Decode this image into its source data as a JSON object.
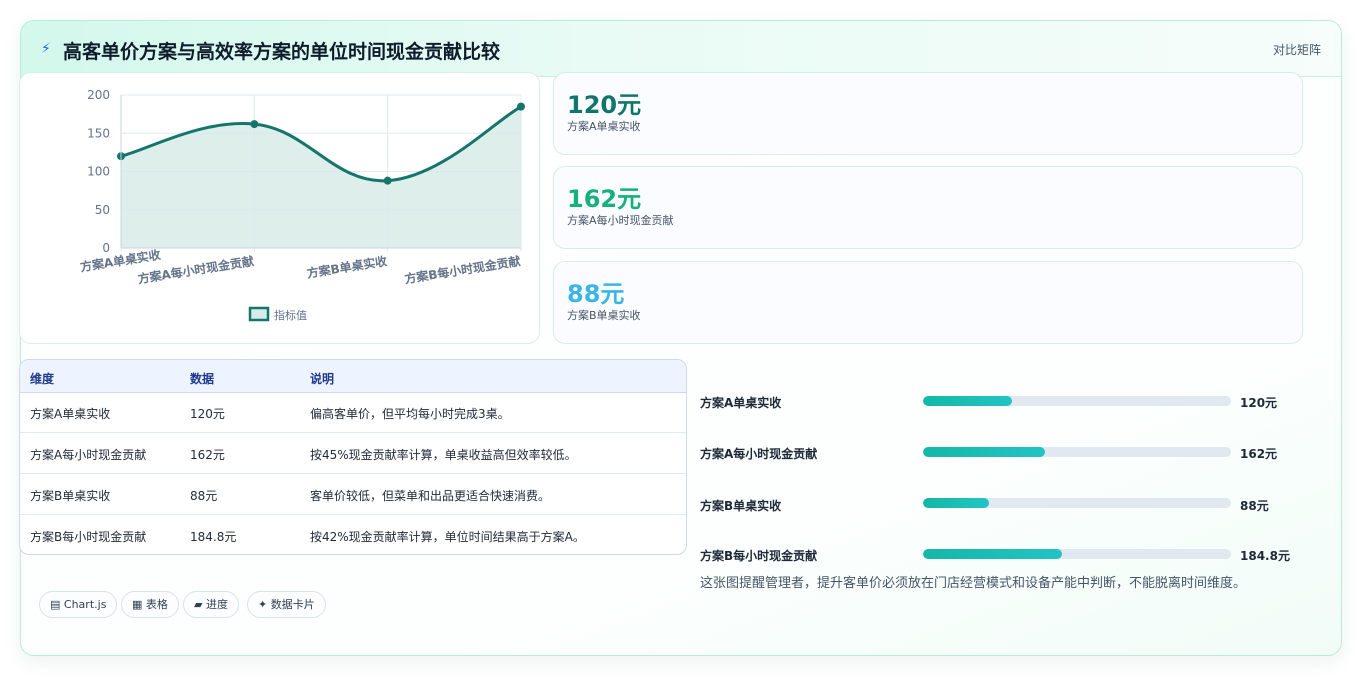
{
  "header": {
    "title": "高客单价方案与高效率方案的单位时间现金贡献比较",
    "matrix_label": "对比矩阵"
  },
  "chart_data": {
    "type": "line",
    "categories": [
      "方案A单桌实收",
      "方案A每小时现金贡献",
      "方案B单桌实收",
      "方案B每小时现金贡献"
    ],
    "series": [
      {
        "name": "指标值",
        "values": [
          120,
          162,
          88,
          184.8
        ]
      }
    ],
    "ylim": [
      0,
      200
    ],
    "yticks": [
      0,
      50,
      100,
      150,
      200
    ],
    "legend": "bottom",
    "grid": true,
    "colors": {
      "line": "#16756b",
      "fill": "#d7ebe8"
    }
  },
  "stats": [
    {
      "value": "120元",
      "label": "方案A单桌实收",
      "color": "#12756b"
    },
    {
      "value": "162元",
      "label": "方案A每小时现金贡献",
      "color": "#16b07a"
    },
    {
      "value": "88元",
      "label": "方案B单桌实收",
      "color": "#3bb5e8"
    }
  ],
  "table": {
    "headers": [
      "维度",
      "数据",
      "说明"
    ],
    "rows": [
      [
        "方案A单桌实收",
        "120元",
        "偏高客单价，但平均每小时完成3桌。"
      ],
      [
        "方案A每小时现金贡献",
        "162元",
        "按45%现金贡献率计算，单桌收益高但效率较低。"
      ],
      [
        "方案B单桌实收",
        "88元",
        "客单价较低，但菜单和出品更适合快速消费。"
      ],
      [
        "方案B每小时现金贡献",
        "184.8元",
        "按42%现金贡献率计算，单位时间结果高于方案A。"
      ]
    ]
  },
  "progress": [
    {
      "label": "方案A单桌实收",
      "value": "120元",
      "fraction": 0.29
    },
    {
      "label": "方案A每小时现金贡献",
      "value": "162元",
      "fraction": 0.395
    },
    {
      "label": "方案B单桌实收",
      "value": "88元",
      "fraction": 0.215
    },
    {
      "label": "方案B每小时现金贡献",
      "value": "184.8元",
      "fraction": 0.45
    }
  ],
  "note": "这张图提醒管理者，提升客单价必须放在门店经营模式和设备产能中判断，不能脱离时间维度。",
  "tags": [
    {
      "icon": "▤",
      "icon_name": "chart-icon",
      "label": "Chart.js"
    },
    {
      "icon": "▦",
      "icon_name": "table-icon",
      "label": "表格"
    },
    {
      "icon": "▰",
      "icon_name": "progress-icon",
      "label": "进度"
    },
    {
      "icon": "✦",
      "icon_name": "sparkle-icon",
      "label": "数据卡片"
    }
  ]
}
